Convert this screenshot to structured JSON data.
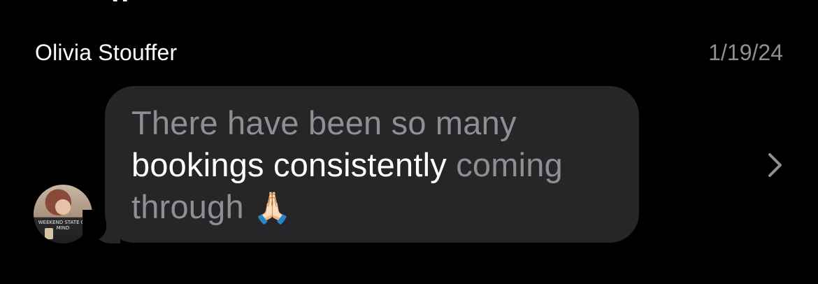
{
  "conversation": {
    "sender_name": "Olivia Stouffer",
    "date": "1/19/24",
    "avatar_shirt_text": "WEEKEND STATE OF MIND"
  },
  "message": {
    "part1": "There have been so many ",
    "highlight": "bookings consistently",
    "part2": " coming through ",
    "emoji": "🙏🏻"
  },
  "icons": {
    "chevron": "chevron-right-icon"
  }
}
